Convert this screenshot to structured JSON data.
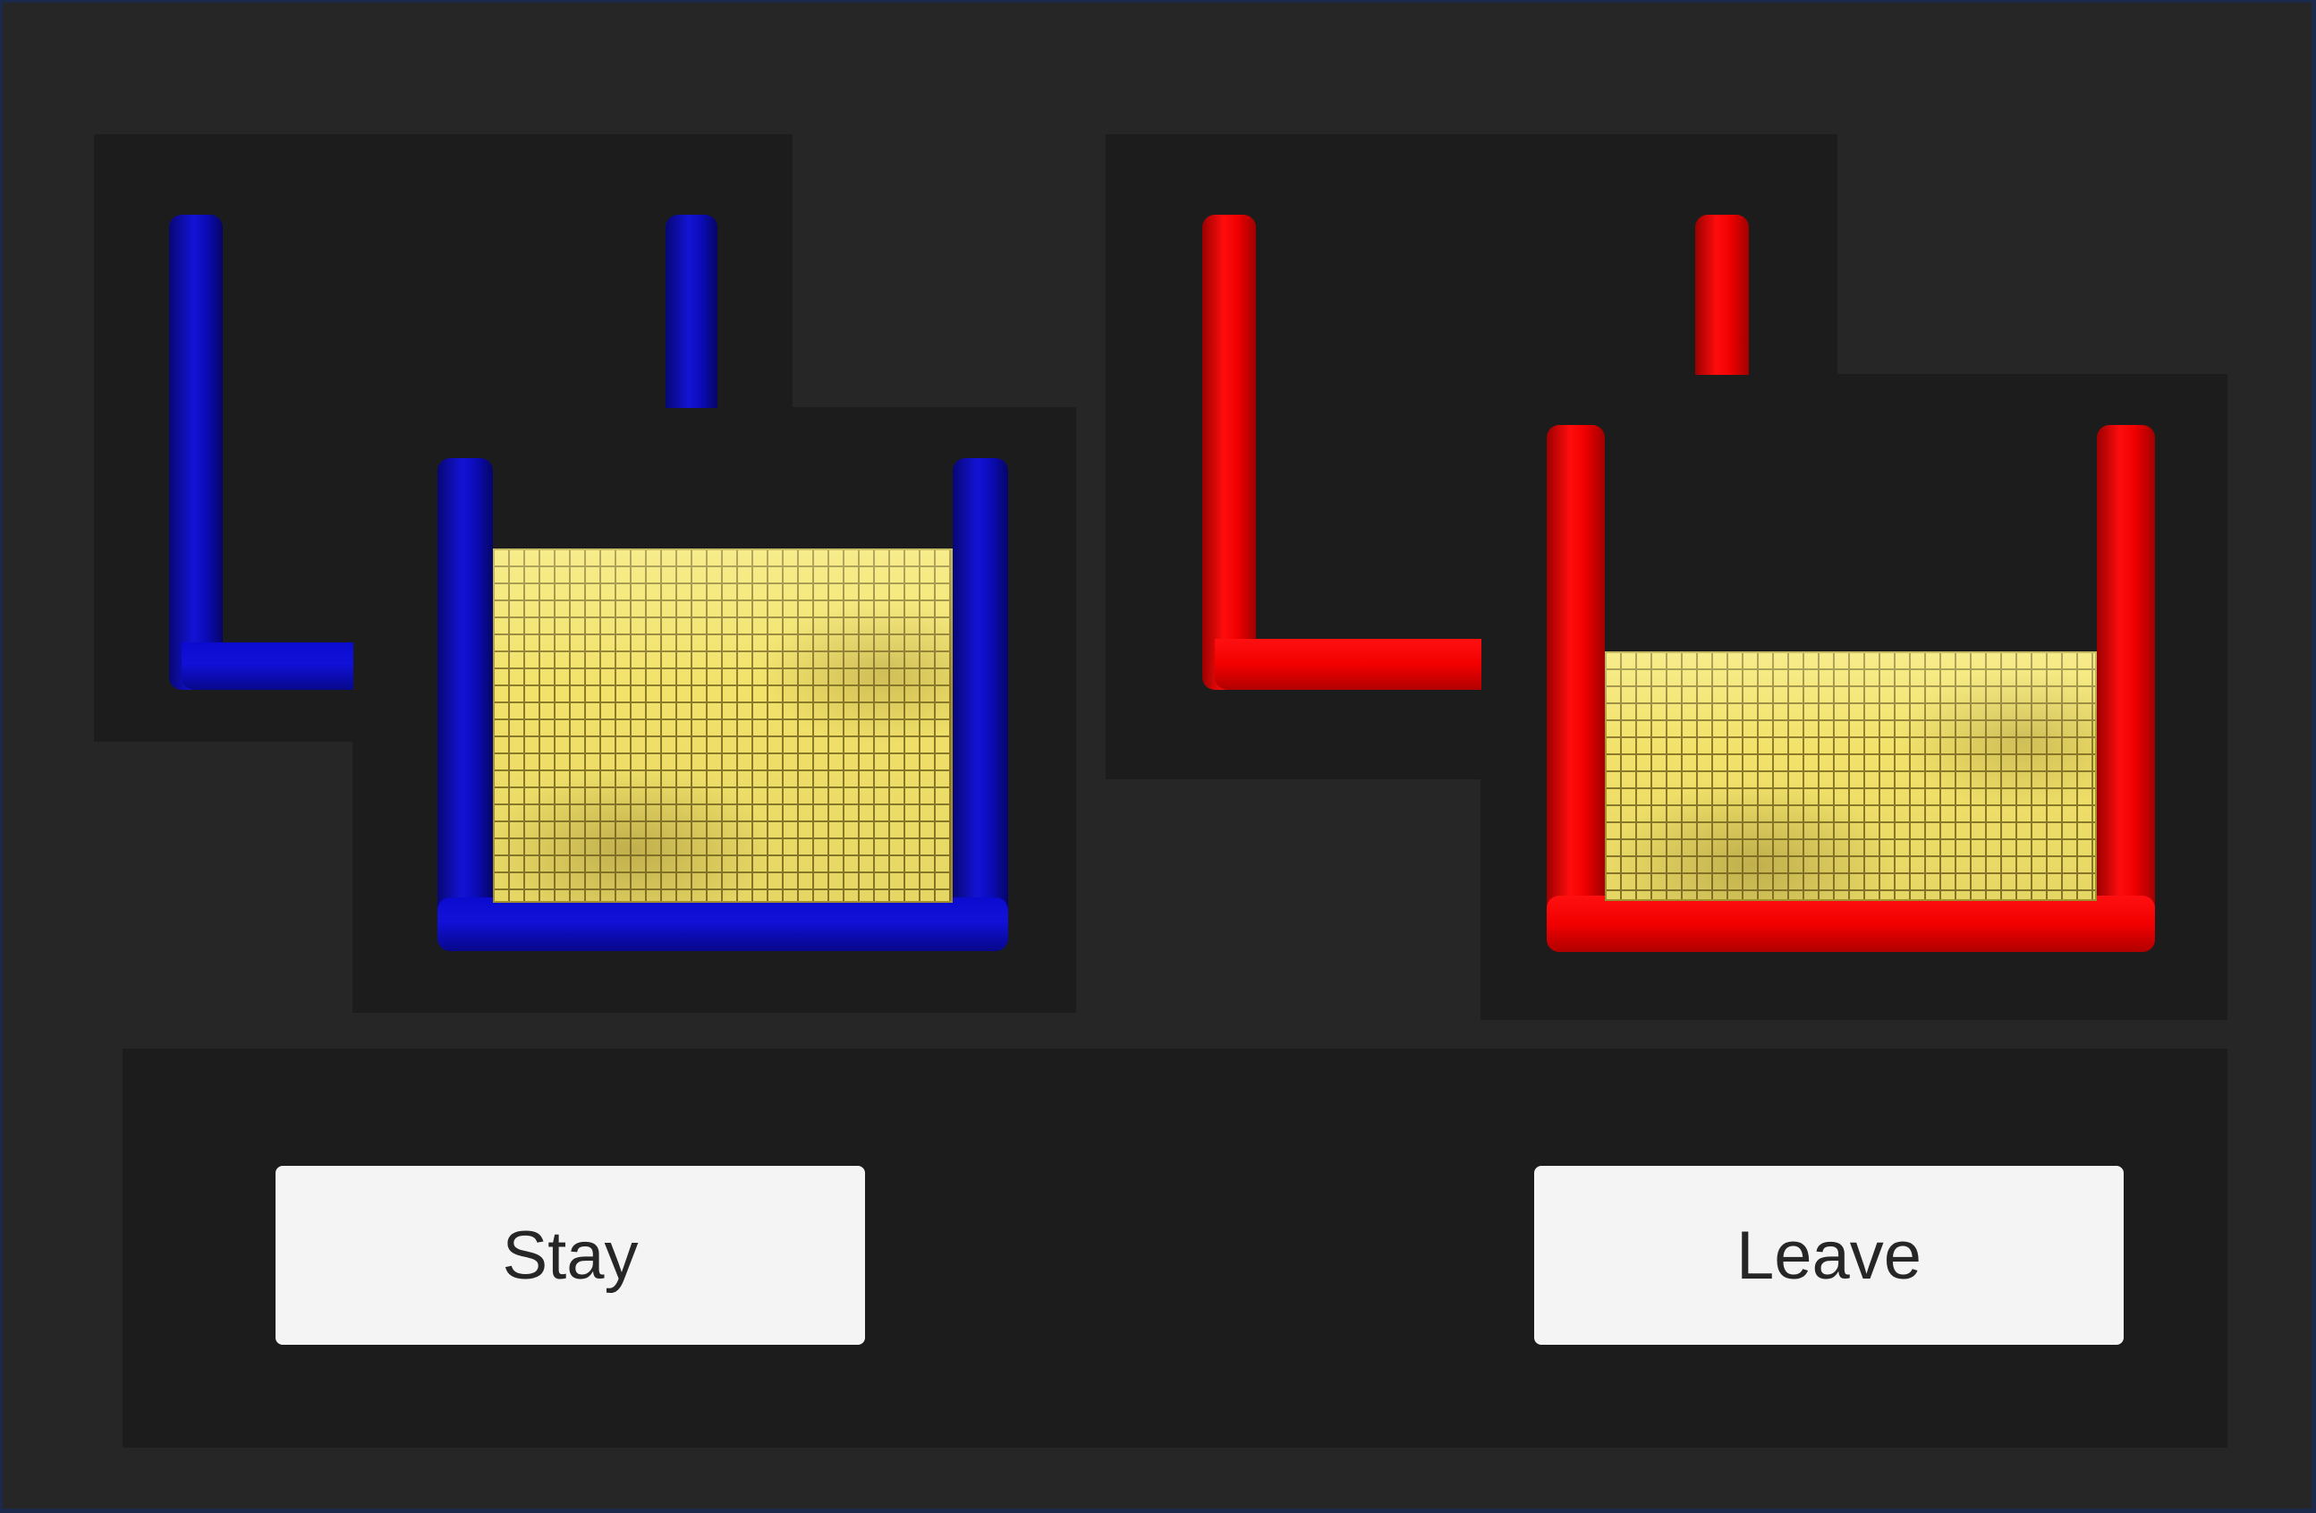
{
  "game": {
    "options": [
      {
        "id": "stay",
        "color": "#1010cc",
        "fill_level": 0.72,
        "button_label": "Stay"
      },
      {
        "id": "leave",
        "color": "#ff0000",
        "fill_level": 0.48,
        "button_label": "Leave"
      }
    ],
    "fill_texture": "gold-bricks",
    "fill_color": "#f2e26a"
  }
}
